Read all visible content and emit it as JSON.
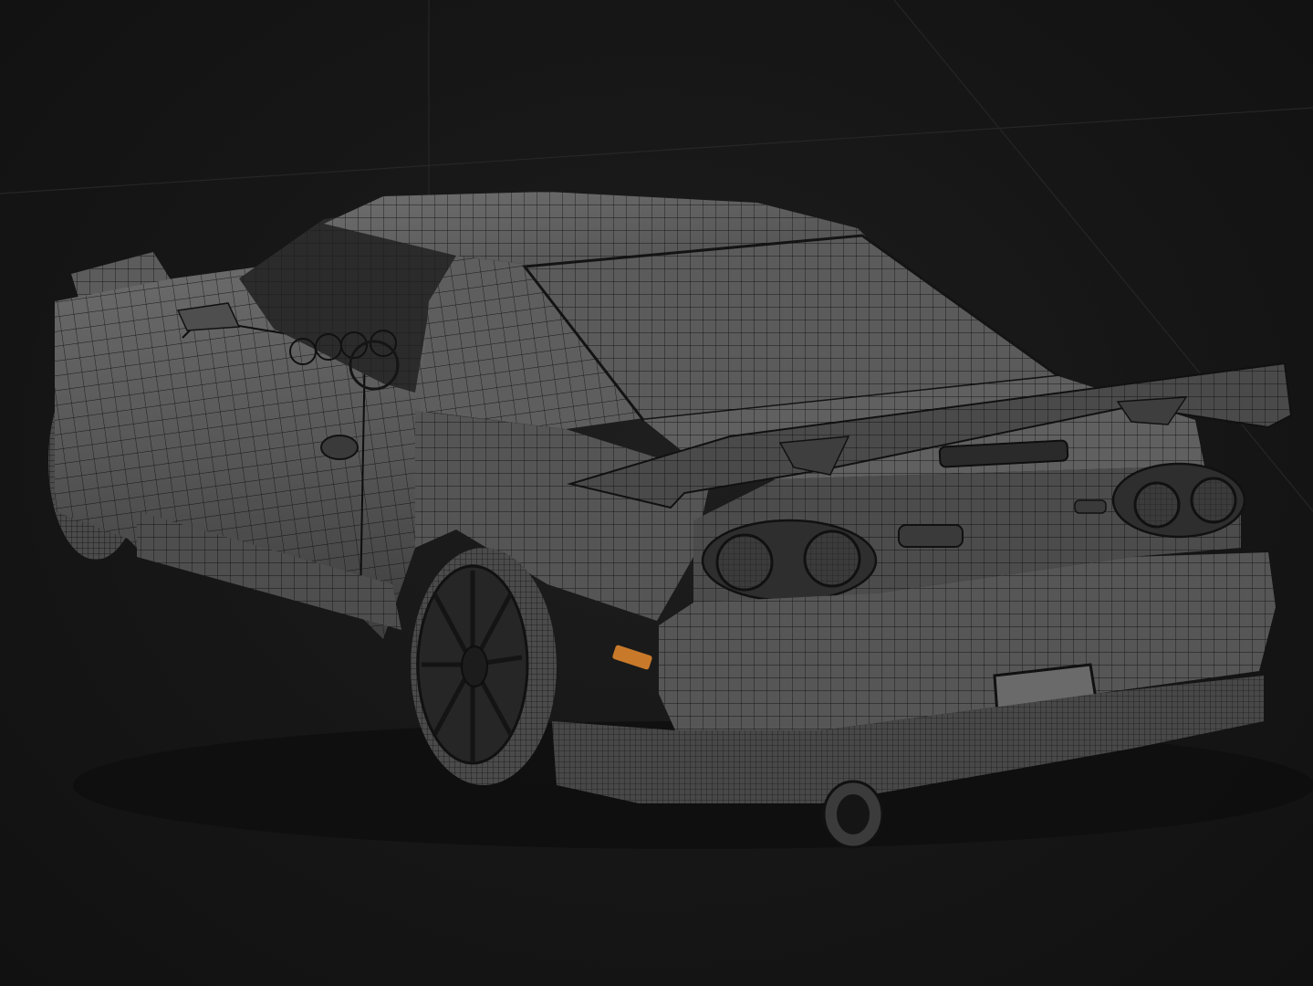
{
  "scene": {
    "background_color": "#151515",
    "mesh_line_color": "#0a0a0a",
    "body_color": "#5a5a5a",
    "body_shadow_color": "#3a3a3a",
    "body_highlight_color": "#7a7a7a",
    "marker_light_color": "#c8792a",
    "grid_line_color": "#2a2a2a"
  },
  "subject": {
    "icon": "wireframe-car-model"
  }
}
